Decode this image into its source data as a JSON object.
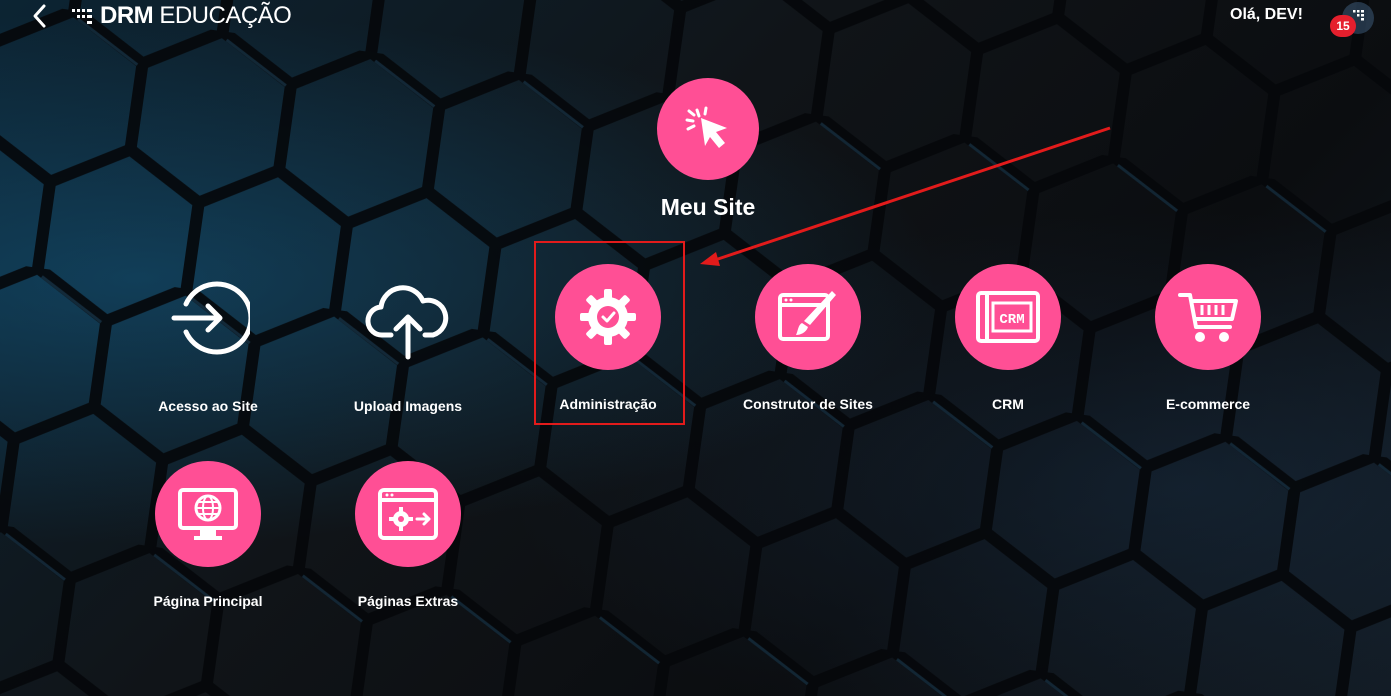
{
  "header": {
    "brand_bold": "DRM",
    "brand_light": "EDUCAÇÃO",
    "greeting": "Olá, DEV!",
    "notification_count": "15"
  },
  "hero": {
    "title": "Meu Site",
    "icon": "cursor-click-icon"
  },
  "tiles": [
    {
      "label": "Acesso ao Site",
      "icon": "login-arrow-icon"
    },
    {
      "label": "Upload Imagens",
      "icon": "cloud-upload-icon"
    },
    {
      "label": "Administração",
      "icon": "gear-check-icon"
    },
    {
      "label": "Construtor de Sites",
      "icon": "browser-brush-icon"
    },
    {
      "label": "CRM",
      "icon": "crm-window-icon"
    },
    {
      "label": "E-commerce",
      "icon": "shopping-cart-icon"
    },
    {
      "label": "Página Principal",
      "icon": "monitor-globe-icon"
    },
    {
      "label": "Páginas Extras",
      "icon": "browser-gear-icon"
    }
  ],
  "annotation": {
    "highlight_color": "#e21b1b"
  },
  "colors": {
    "accent": "#ff4f95"
  }
}
